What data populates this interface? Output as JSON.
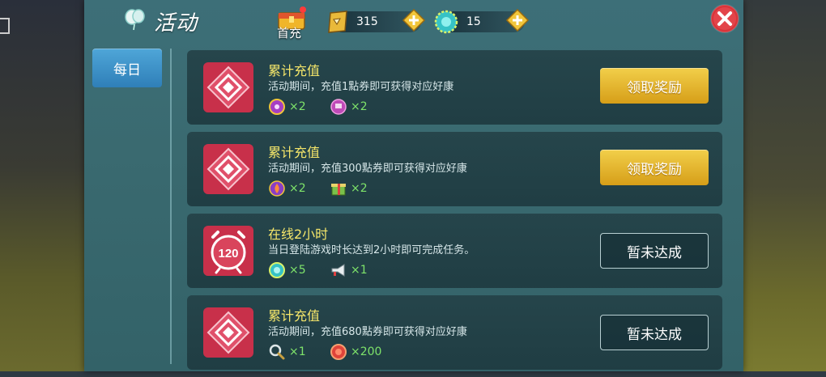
{
  "header": {
    "title": "活动",
    "first_pay_label": "首充",
    "gold_amount": "315",
    "gem_amount": "15"
  },
  "tabs": [
    {
      "label": "每日",
      "active": true
    }
  ],
  "tasks": [
    {
      "title": "累计充值",
      "desc": "活动期间，充值1點券即可获得对应好康",
      "icon": "diamond-badge-icon",
      "rewards": [
        {
          "icon": "purple-orb-icon",
          "count": "×2"
        },
        {
          "icon": "purple-gem-icon",
          "count": "×2"
        }
      ],
      "button": "领取奖励",
      "button_state": "claim"
    },
    {
      "title": "累计充值",
      "desc": "活动期间，充值300點券即可获得对应好康",
      "icon": "diamond-badge-icon",
      "rewards": [
        {
          "icon": "flame-orb-icon",
          "count": "×2"
        },
        {
          "icon": "gift-box-icon",
          "count": "×2"
        }
      ],
      "button": "领取奖励",
      "button_state": "claim"
    },
    {
      "title": "在线2小时",
      "desc": "当日登陆游戏时长达到2小时即可完成任务。",
      "icon": "clock-120-icon",
      "icon_text": "120",
      "rewards": [
        {
          "icon": "teal-coin-icon",
          "count": "×5"
        },
        {
          "icon": "megaphone-icon",
          "count": "×1"
        }
      ],
      "button": "暂未达成",
      "button_state": "pending"
    },
    {
      "title": "累计充值",
      "desc": "活动期间，充值680點券即可获得对应好康",
      "icon": "diamond-badge-icon",
      "rewards": [
        {
          "icon": "magnifier-icon",
          "count": "×1"
        },
        {
          "icon": "red-coin-icon",
          "count": "×200"
        }
      ],
      "button": "暂未达成",
      "button_state": "pending"
    }
  ],
  "colors": {
    "panel": "#3a6a70",
    "task_title": "#f5e66a",
    "reward_count": "#7ee36a",
    "claim_button": "#e6b630",
    "tab_active": "#3f92c8",
    "close_button": "#d8343a"
  }
}
